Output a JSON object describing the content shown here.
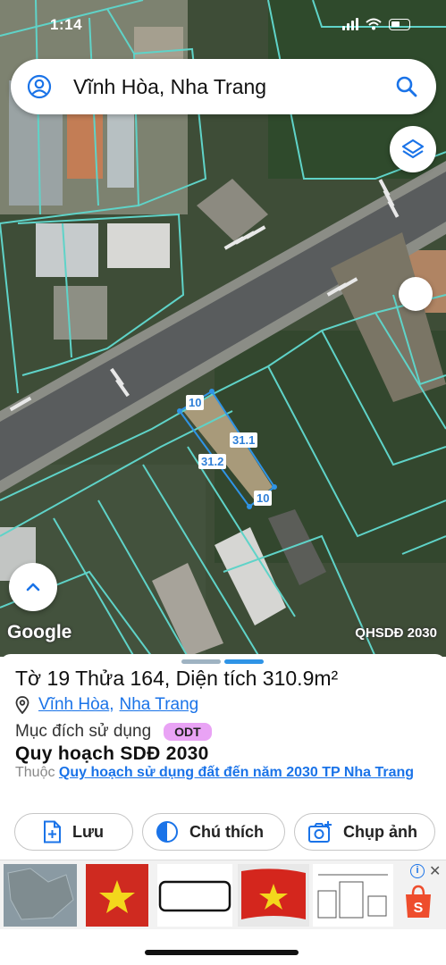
{
  "status": {
    "time": "1:14"
  },
  "search": {
    "location_text": "Vĩnh Hòa, Nha Trang"
  },
  "map": {
    "dimension_labels": [
      "10",
      "31.1",
      "31.2",
      "10"
    ],
    "google_text": "Google",
    "layer_label": "QHSDĐ 2030"
  },
  "parcel": {
    "title": "Tờ 19 Thửa 164, Diện tích 310.9m²",
    "ward": "Vĩnh Hòa",
    "separator": ",",
    "city": "Nha Trang",
    "purpose_label": "Mục đích sử dụng",
    "purpose_code": "ODT",
    "plan_title": "Quy hoạch SDĐ 2030",
    "belongs_prefix": "Thuộc",
    "belongs_link": "Quy hoạch sử dụng đất đến năm 2030 TP Nha Trang"
  },
  "actions": {
    "save_label": "Lưu",
    "legend_label": "Chú thích",
    "photo_label": "Chụp ảnh"
  },
  "ad": {
    "info": "i",
    "close": "✕"
  },
  "colors": {
    "accent": "#1a73e8",
    "parcel_outline": "#5fd3c8",
    "odt_badge": "#e9a3f5",
    "measure_line": "#2f94e6"
  }
}
